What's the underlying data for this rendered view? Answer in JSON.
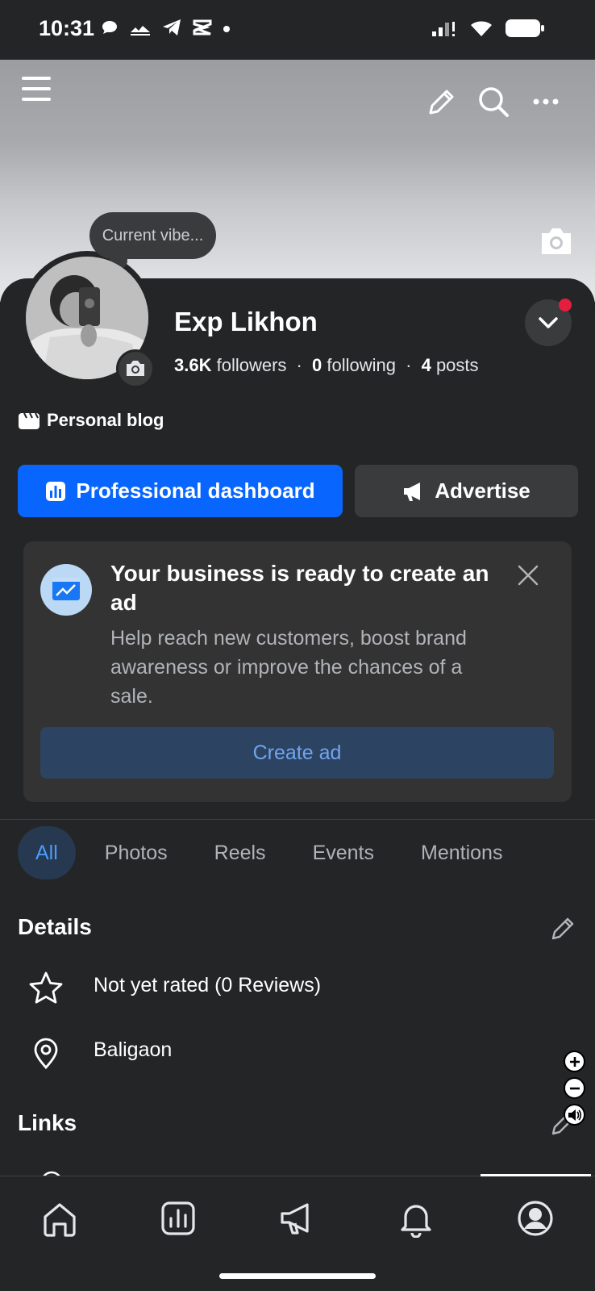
{
  "status_bar": {
    "time": "10:31",
    "left_icons": [
      "chat-bubble-icon",
      "image-icon",
      "telegram-icon",
      "capcut-icon",
      "dot-icon"
    ],
    "right_icons": [
      "signal-icon",
      "wifi-icon",
      "battery-icon"
    ]
  },
  "header": {
    "icons": [
      "menu-icon",
      "edit-icon",
      "search-icon",
      "more-icon"
    ]
  },
  "profile": {
    "note": "Current vibe...",
    "name": "Exp Likhon",
    "followers_count": "3.6K",
    "followers_label": "followers",
    "separator": "·",
    "following_count": "0",
    "following_label": "following",
    "posts_count": "4",
    "posts_label": "posts",
    "category": "Personal blog"
  },
  "actions": {
    "professional_dashboard": "Professional dashboard",
    "advertise": "Advertise"
  },
  "ad_card": {
    "title": "Your business is ready to create an ad",
    "description": "Help reach new customers, boost brand awareness or improve the chances of a sale.",
    "cta": "Create ad"
  },
  "tabs": [
    {
      "label": "All",
      "active": true
    },
    {
      "label": "Photos",
      "active": false
    },
    {
      "label": "Reels",
      "active": false
    },
    {
      "label": "Events",
      "active": false
    },
    {
      "label": "Mentions",
      "active": false
    }
  ],
  "details": {
    "title": "Details",
    "rating": "Not yet rated (0 Reviews)",
    "location": "Baligaon"
  },
  "links": {
    "title": "Links"
  },
  "bottom_nav": [
    "home-icon",
    "dashboard-icon",
    "megaphone-icon",
    "bell-icon",
    "profile-icon"
  ],
  "colors": {
    "background": "#242526",
    "primary": "#0866ff",
    "secondary_button": "#3a3b3c",
    "notification_dot": "#e41e3f",
    "active_tab_text": "#4d9bf7"
  }
}
